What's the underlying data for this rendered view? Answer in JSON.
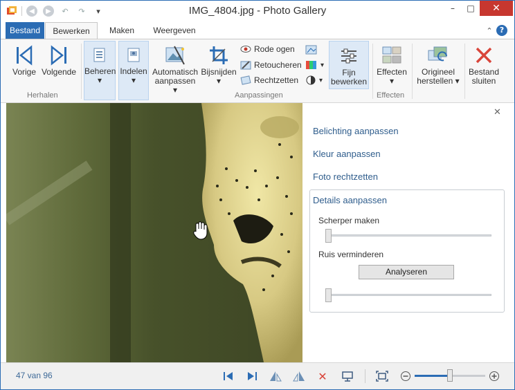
{
  "window": {
    "title": "IMG_4804.jpg - Photo Gallery",
    "controls": {
      "minimize": "–",
      "maximize": "□",
      "close": "✕"
    }
  },
  "tabs": [
    {
      "label": "Bestand",
      "state": "file"
    },
    {
      "label": "Bewerken",
      "state": "active"
    },
    {
      "label": "Maken"
    },
    {
      "label": "Weergeven"
    }
  ],
  "ribbon": {
    "vorige": "Vorige",
    "volgende": "Volgende",
    "group_herhalen": "Herhalen",
    "beheren": "Beheren",
    "indelen": "Indelen",
    "auto_line1": "Automatisch",
    "auto_line2": "aanpassen",
    "bijsnijden": "Bijsnijden",
    "rode_ogen": "Rode ogen",
    "retoucheren": "Retoucheren",
    "rechtzetten": "Rechtzetten",
    "fijn_line1": "Fijn",
    "fijn_line2": "bewerken",
    "group_aanpassingen": "Aanpassingen",
    "effecten": "Effecten",
    "group_effecten": "Effecten",
    "orig_line1": "Origineel",
    "orig_line2": "herstellen",
    "sluit_line1": "Bestand",
    "sluit_line2": "sluiten"
  },
  "panel": {
    "close": "✕",
    "belichting": "Belichting aanpassen",
    "kleur": "Kleur aanpassen",
    "rechtzetten": "Foto rechtzetten",
    "details": "Details aanpassen",
    "scherper": "Scherper maken",
    "ruis": "Ruis verminderen",
    "analyseren": "Analyseren",
    "sharpen_value": 0,
    "noise_value": 0
  },
  "status": {
    "position": "47 van 96",
    "zoom_value": 0.5
  },
  "colors": {
    "accent": "#2b6cb4",
    "link": "#2f5d8c",
    "close_red": "#c7372f"
  }
}
